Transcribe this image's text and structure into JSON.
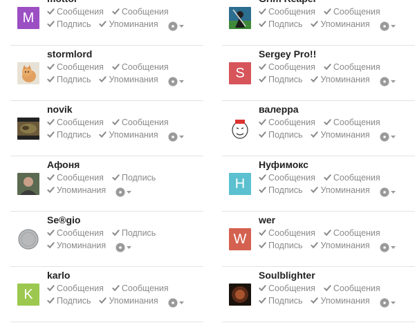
{
  "members": [
    {
      "name": "mottor",
      "avatar": {
        "type": "letter",
        "letter": "M",
        "color": "#9b4fc3"
      },
      "line1": [
        "Сообщения",
        "Сообщения"
      ],
      "line2": [
        "Подпись",
        "Упоминания"
      ],
      "gear_line": 2
    },
    {
      "name": "Grim Reaper",
      "avatar": {
        "type": "image",
        "image": "grim-reaper-avatar"
      },
      "line1": [
        "Сообщения",
        "Сообщения"
      ],
      "line2": [
        "Подпись",
        "Упоминания"
      ],
      "gear_line": 2
    },
    {
      "name": "stormlord",
      "avatar": {
        "type": "image",
        "image": "cat-avatar"
      },
      "line1": [
        "Сообщения",
        "Сообщения"
      ],
      "line2": [
        "Подпись",
        "Упоминания"
      ],
      "gear_line": 2
    },
    {
      "name": "Sergey Pro!!",
      "avatar": {
        "type": "letter",
        "letter": "S",
        "color": "#d6545a"
      },
      "line1": [
        "Сообщения",
        "Сообщения"
      ],
      "line2": [
        "Подпись",
        "Упоминания"
      ],
      "gear_line": 2
    },
    {
      "name": "novik",
      "avatar": {
        "type": "image",
        "image": "novik-avatar"
      },
      "line1": [
        "Сообщения",
        "Сообщения"
      ],
      "line2": [
        "Подпись",
        "Упоминания"
      ],
      "gear_line": 2
    },
    {
      "name": "валерра",
      "avatar": {
        "type": "image",
        "image": "rage-face-avatar"
      },
      "line1": [
        "Сообщения",
        "Сообщения"
      ],
      "line2": [
        "Подпись",
        "Упоминания"
      ],
      "gear_line": 2
    },
    {
      "name": "Афоня",
      "avatar": {
        "type": "image",
        "image": "man-avatar"
      },
      "line1": [
        "Сообщения",
        "Подпись"
      ],
      "line2": [
        "Упоминания"
      ],
      "gear_line": 2
    },
    {
      "name": "Нуфимокс",
      "avatar": {
        "type": "letter",
        "letter": "H",
        "color": "#5bc0cf"
      },
      "line1": [
        "Сообщения",
        "Сообщения"
      ],
      "line2": [
        "Подпись",
        "Упоминания"
      ],
      "gear_line": 2
    },
    {
      "name": "Se®gio",
      "avatar": {
        "type": "image",
        "image": "coin-avatar"
      },
      "line1": [
        "Сообщения",
        "Подпись"
      ],
      "line2": [
        "Упоминания"
      ],
      "gear_line": 2
    },
    {
      "name": "wer",
      "avatar": {
        "type": "letter",
        "letter": "W",
        "color": "#d4614f"
      },
      "line1": [
        "Сообщения",
        "Сообщения"
      ],
      "line2": [
        "Подпись",
        "Упоминания"
      ],
      "gear_line": 2
    },
    {
      "name": "karlo",
      "avatar": {
        "type": "letter",
        "letter": "K",
        "color": "#9cc84f"
      },
      "line1": [
        "Сообщения",
        "Сообщения"
      ],
      "line2": [
        "Подпись",
        "Упоминания"
      ],
      "gear_line": 2
    },
    {
      "name": "Soulblighter",
      "avatar": {
        "type": "image",
        "image": "soulblighter-avatar"
      },
      "line1": [
        "Сообщения",
        "Сообщения"
      ],
      "line2": [
        "Подпись",
        "Упоминания"
      ],
      "gear_line": 2
    }
  ],
  "colors": {
    "check": "#8a8a8a",
    "name": "#222222",
    "separator": "#e3e3e3"
  }
}
